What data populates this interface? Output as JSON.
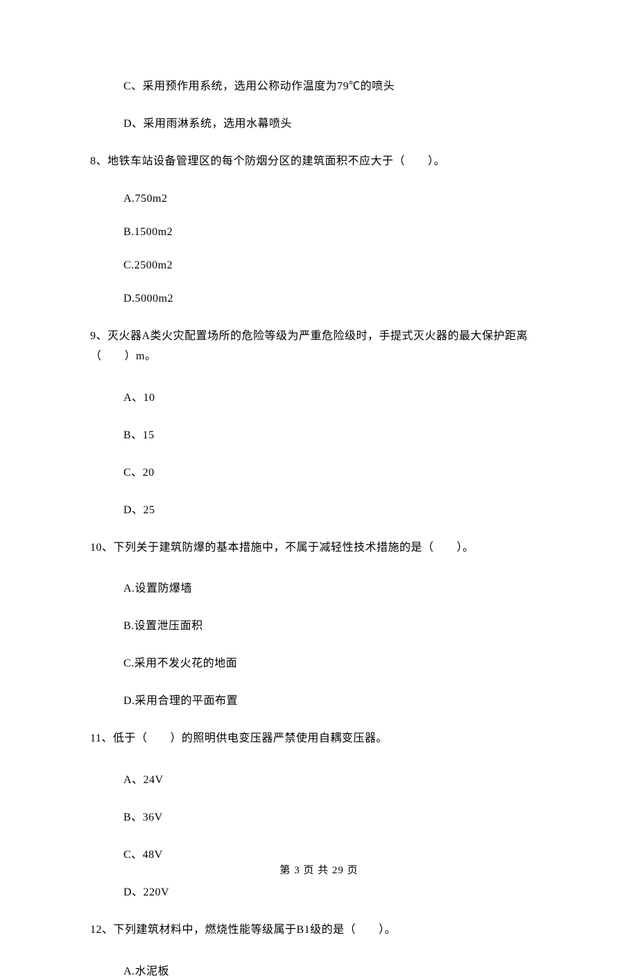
{
  "q7": {
    "optC": "C、采用预作用系统，选用公称动作温度为79℃的喷头",
    "optD": "D、采用雨淋系统，选用水幕喷头"
  },
  "q8": {
    "stem": "8、地铁车站设备管理区的每个防烟分区的建筑面积不应大于（　　）。",
    "optA": "A.750m2",
    "optB": "B.1500m2",
    "optC": "C.2500m2",
    "optD": "D.5000m2"
  },
  "q9": {
    "stem": "9、灭火器A类火灾配置场所的危险等级为严重危险级时，手提式灭火器的最大保护距离（　　）m。",
    "optA": "A、10",
    "optB": "B、15",
    "optC": "C、20",
    "optD": "D、25"
  },
  "q10": {
    "stem": "10、下列关于建筑防爆的基本措施中，不属于减轻性技术措施的是（　　）。",
    "optA": "A.设置防爆墙",
    "optB": "B.设置泄压面积",
    "optC": "C.采用不发火花的地面",
    "optD": "D.采用合理的平面布置"
  },
  "q11": {
    "stem": "11、低于（　　）的照明供电变压器严禁使用自耦变压器。",
    "optA": "A、24V",
    "optB": "B、36V",
    "optC": "C、48V",
    "optD": "D、220V"
  },
  "q12": {
    "stem": "12、下列建筑材料中，燃烧性能等级属于B1级的是（　　）。",
    "optA": "A.水泥板"
  },
  "footer": "第 3 页 共 29 页"
}
